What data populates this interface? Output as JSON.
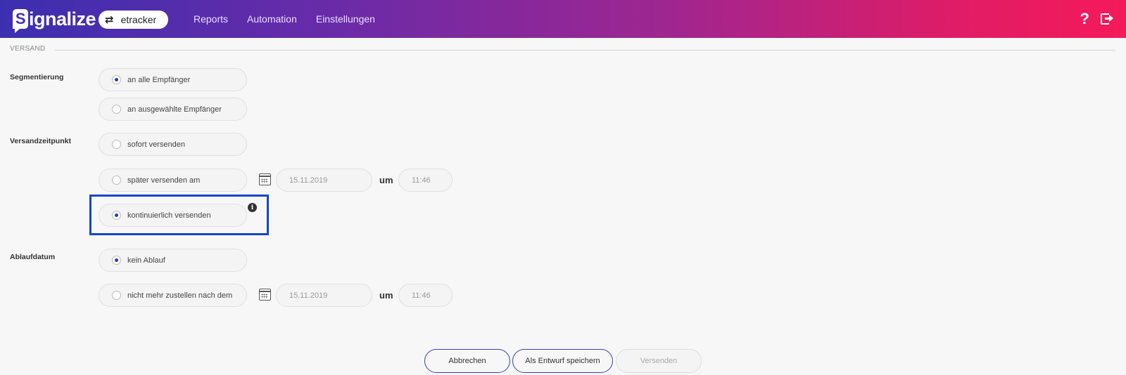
{
  "header": {
    "brand": "ignalize",
    "brand_initial": "S",
    "env_label": "etracker",
    "nav": [
      "Reports",
      "Automation",
      "Einstellungen"
    ],
    "help": "?"
  },
  "section": {
    "title": "VERSAND"
  },
  "segmentierung": {
    "label": "Segmentierung",
    "options": [
      {
        "label": "an alle Empfänger",
        "checked": true
      },
      {
        "label": "an ausgewählte Empfänger",
        "checked": false
      }
    ]
  },
  "versandzeitpunkt": {
    "label": "Versandzeitpunkt",
    "options": [
      {
        "label": "sofort versenden",
        "checked": false
      },
      {
        "label": "später versenden am",
        "checked": false
      },
      {
        "label": "kontinuierlich versenden",
        "checked": true
      }
    ],
    "date": "15.11.2019",
    "um": "um",
    "time": "11:46",
    "info": "i"
  },
  "ablaufdatum": {
    "label": "Ablaufdatum",
    "options": [
      {
        "label": "kein Ablauf",
        "checked": true
      },
      {
        "label": "nicht mehr zustellen nach dem",
        "checked": false
      }
    ],
    "date": "15.11.2019",
    "um": "um",
    "time": "11:46"
  },
  "actions": {
    "cancel": "Abbrechen",
    "draft": "Als Entwurf speichern",
    "send": "Versenden"
  },
  "colors": {
    "accent": "#2a3bb4",
    "highlight": "#1646c8"
  }
}
